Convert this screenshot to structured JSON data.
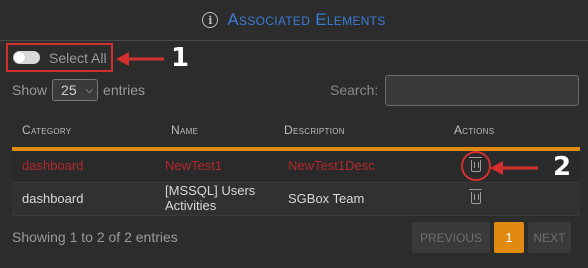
{
  "header": {
    "title": "Associated Elements",
    "icon": "info-icon"
  },
  "select_all": {
    "label": "Select All",
    "checked": false
  },
  "callouts": [
    "1",
    "2"
  ],
  "length": {
    "prefix": "Show",
    "value": "25",
    "suffix": "entries"
  },
  "search": {
    "label": "Search:",
    "value": ""
  },
  "table": {
    "columns": [
      "Category",
      "Name",
      "Description",
      "Actions"
    ],
    "rows": [
      {
        "category": "dashboard",
        "name": "NewTest1",
        "description": "NewTest1Desc",
        "highlighted": true
      },
      {
        "category": "dashboard",
        "name_line1": "[MSSQL] Users",
        "name_line2": "Activities",
        "description": "SGBox Team",
        "highlighted": false
      }
    ]
  },
  "footer": {
    "info": "Showing 1 to 2 of 2 entries",
    "prev": "PREVIOUS",
    "page": "1",
    "next": "NEXT"
  },
  "colors": {
    "accent": "#e08a12",
    "title": "#3a7bd5",
    "highlight_text": "#b3282d",
    "annotation": "#d32f2f"
  }
}
